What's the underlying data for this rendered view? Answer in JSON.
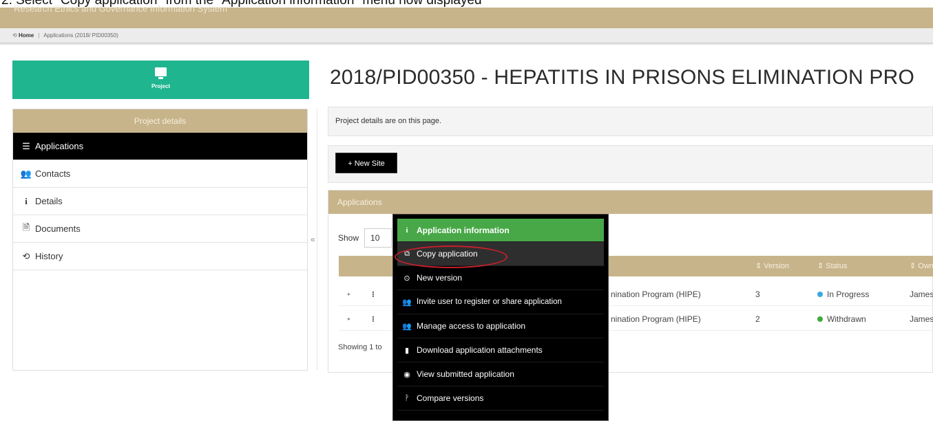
{
  "instruction": "2.   Select \"Copy application\" from the \"Application information\" menu now displayed",
  "header": {
    "system_name": "Research Ethics and Governance Information System"
  },
  "breadcrumb": {
    "home": "Home",
    "separator": "|",
    "current": "Applications (2018/ PID00350)"
  },
  "project_button": {
    "label": "Project",
    "icon": "monitor-icon"
  },
  "sidebar": {
    "heading": "Project details",
    "items": [
      {
        "label": "Applications",
        "icon": "table-icon",
        "active": true
      },
      {
        "label": "Contacts",
        "icon": "users-icon"
      },
      {
        "label": "Details",
        "icon": "info-icon"
      },
      {
        "label": "Documents",
        "icon": "file-icon"
      },
      {
        "label": "History",
        "icon": "history-icon"
      }
    ],
    "collapse": "«"
  },
  "page": {
    "title": "2018/PID00350 - HEPATITIS IN PRISONS ELIMINATION PRO",
    "info_text": "Project details are on this page.",
    "new_site_label": "+ New Site"
  },
  "applications": {
    "heading": "Applications",
    "show_label": "Show",
    "show_value": "10",
    "columns": [
      "⇕ Version",
      "⇕ Status",
      "⇕ Own"
    ],
    "rows": [
      {
        "title": "nination Program (HIPE)",
        "version": "3",
        "status": "In Progress",
        "status_color": "#3aa7e0",
        "owner": "James"
      },
      {
        "title": "nination Program (HIPE)",
        "version": "2",
        "status": "Withdrawn",
        "status_color": "#3cab3c",
        "owner": "James"
      }
    ],
    "showing_text": "Showing 1 to"
  },
  "context_menu": {
    "items": [
      {
        "label": "Application information",
        "icon": "i"
      },
      {
        "label": "Copy application",
        "icon": "⧉"
      },
      {
        "label": "New version",
        "icon": "⊙"
      },
      {
        "label": "Invite user to register or share application",
        "icon": "👥"
      },
      {
        "label": "Manage access to application",
        "icon": "👥"
      },
      {
        "label": "Download application attachments",
        "icon": "▮"
      },
      {
        "label": "View submitted application",
        "icon": "◉"
      },
      {
        "label": "Compare versions",
        "icon": "ᚹ"
      }
    ]
  },
  "colors": {
    "accent_tan": "#c8b48a",
    "project_green": "#1fb58f",
    "menu_green": "#48a848",
    "highlight_red": "#c8202a"
  }
}
